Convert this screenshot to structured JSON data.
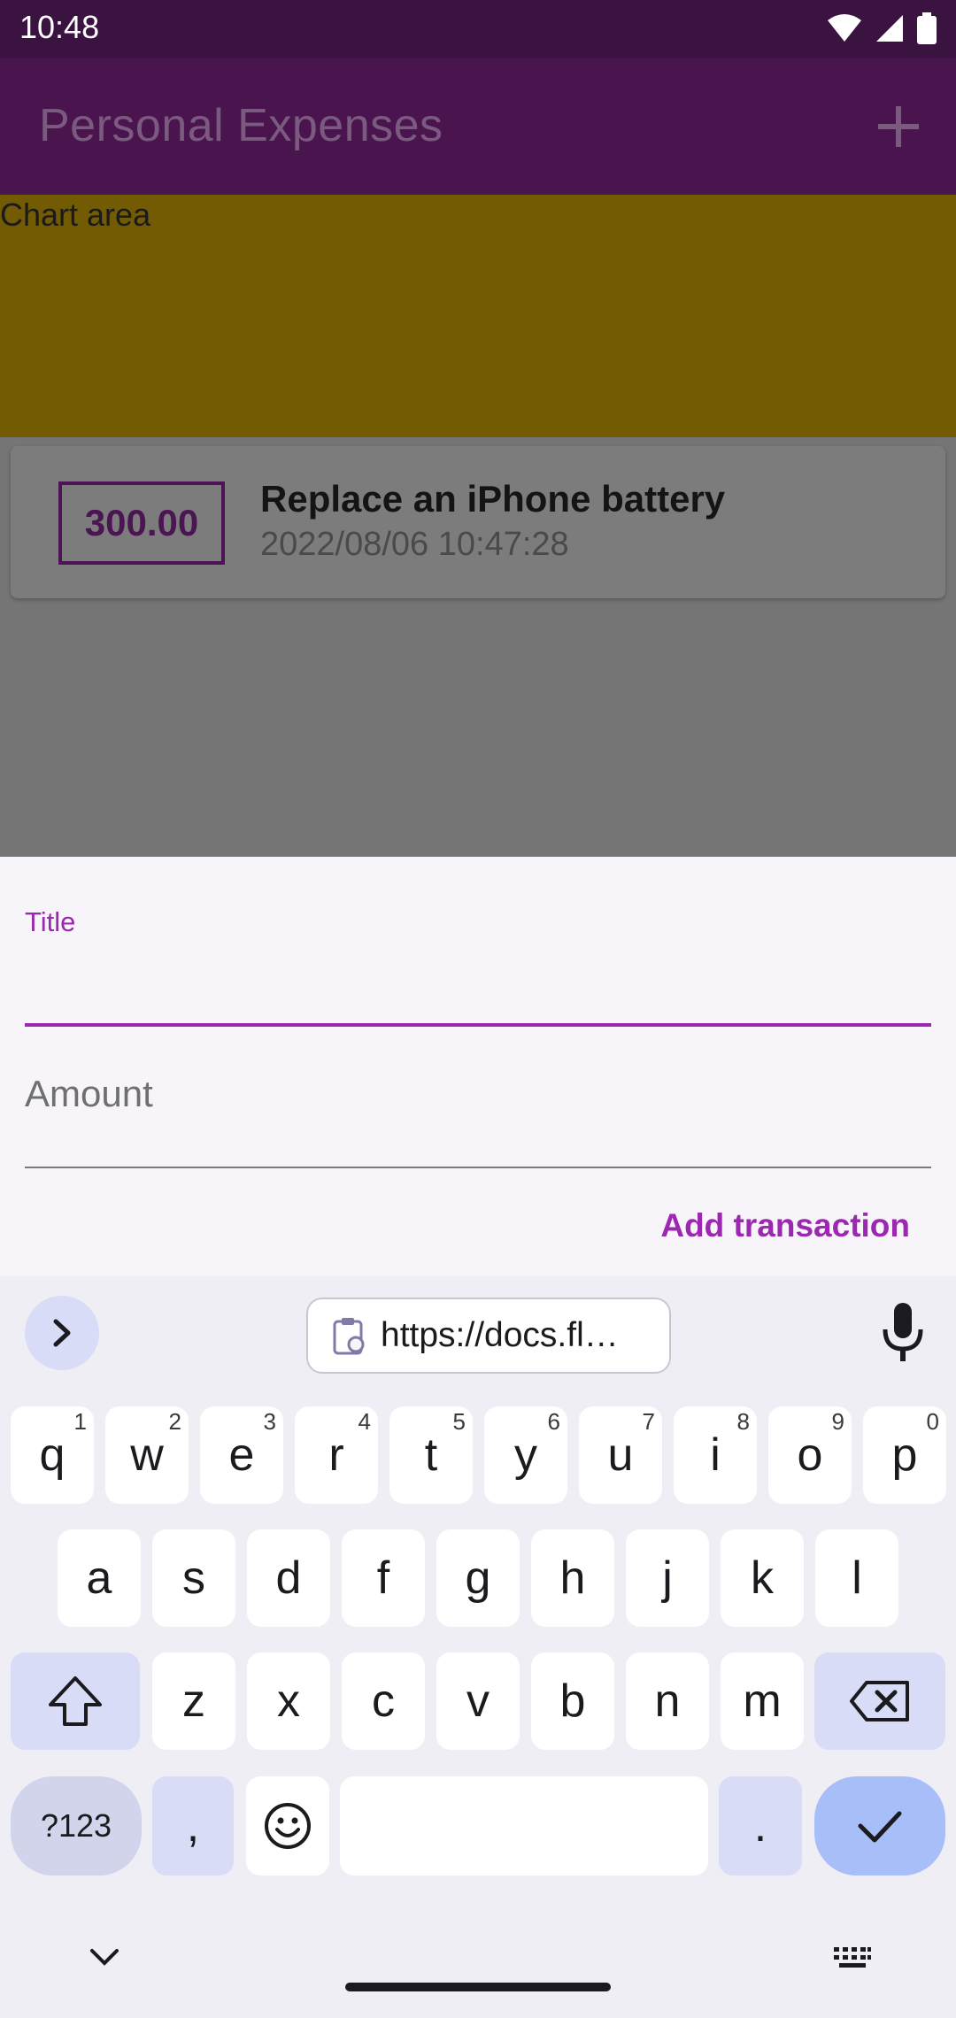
{
  "status_bar": {
    "time": "10:48",
    "icons": [
      "wifi-icon",
      "cellular-icon",
      "battery-icon"
    ]
  },
  "app_bar": {
    "title": "Personal Expenses",
    "add_icon": "plus-icon"
  },
  "chart": {
    "label": "Chart area"
  },
  "transactions": [
    {
      "amount": "300.00",
      "title": "Replace an iPhone battery",
      "date": "2022/08/06 10:47:28"
    }
  ],
  "form": {
    "title_label": "Title",
    "title_value": "",
    "amount_placeholder": "Amount",
    "submit_label": "Add transaction"
  },
  "keyboard": {
    "clipboard_text": "https://docs.fl…",
    "row1": [
      {
        "k": "q",
        "h": "1"
      },
      {
        "k": "w",
        "h": "2"
      },
      {
        "k": "e",
        "h": "3"
      },
      {
        "k": "r",
        "h": "4"
      },
      {
        "k": "t",
        "h": "5"
      },
      {
        "k": "y",
        "h": "6"
      },
      {
        "k": "u",
        "h": "7"
      },
      {
        "k": "i",
        "h": "8"
      },
      {
        "k": "o",
        "h": "9"
      },
      {
        "k": "p",
        "h": "0"
      }
    ],
    "row2": [
      "a",
      "s",
      "d",
      "f",
      "g",
      "h",
      "j",
      "k",
      "l"
    ],
    "row3": [
      "z",
      "x",
      "c",
      "v",
      "b",
      "n",
      "m"
    ],
    "symbols_label": "?123",
    "comma": ",",
    "period": "."
  },
  "colors": {
    "primary": "#9c27b0",
    "app_bar": "#4a154f",
    "status_bar": "#3b1340",
    "chart_bg": "#735b04",
    "keyboard_accent": "#d8dcf6"
  }
}
